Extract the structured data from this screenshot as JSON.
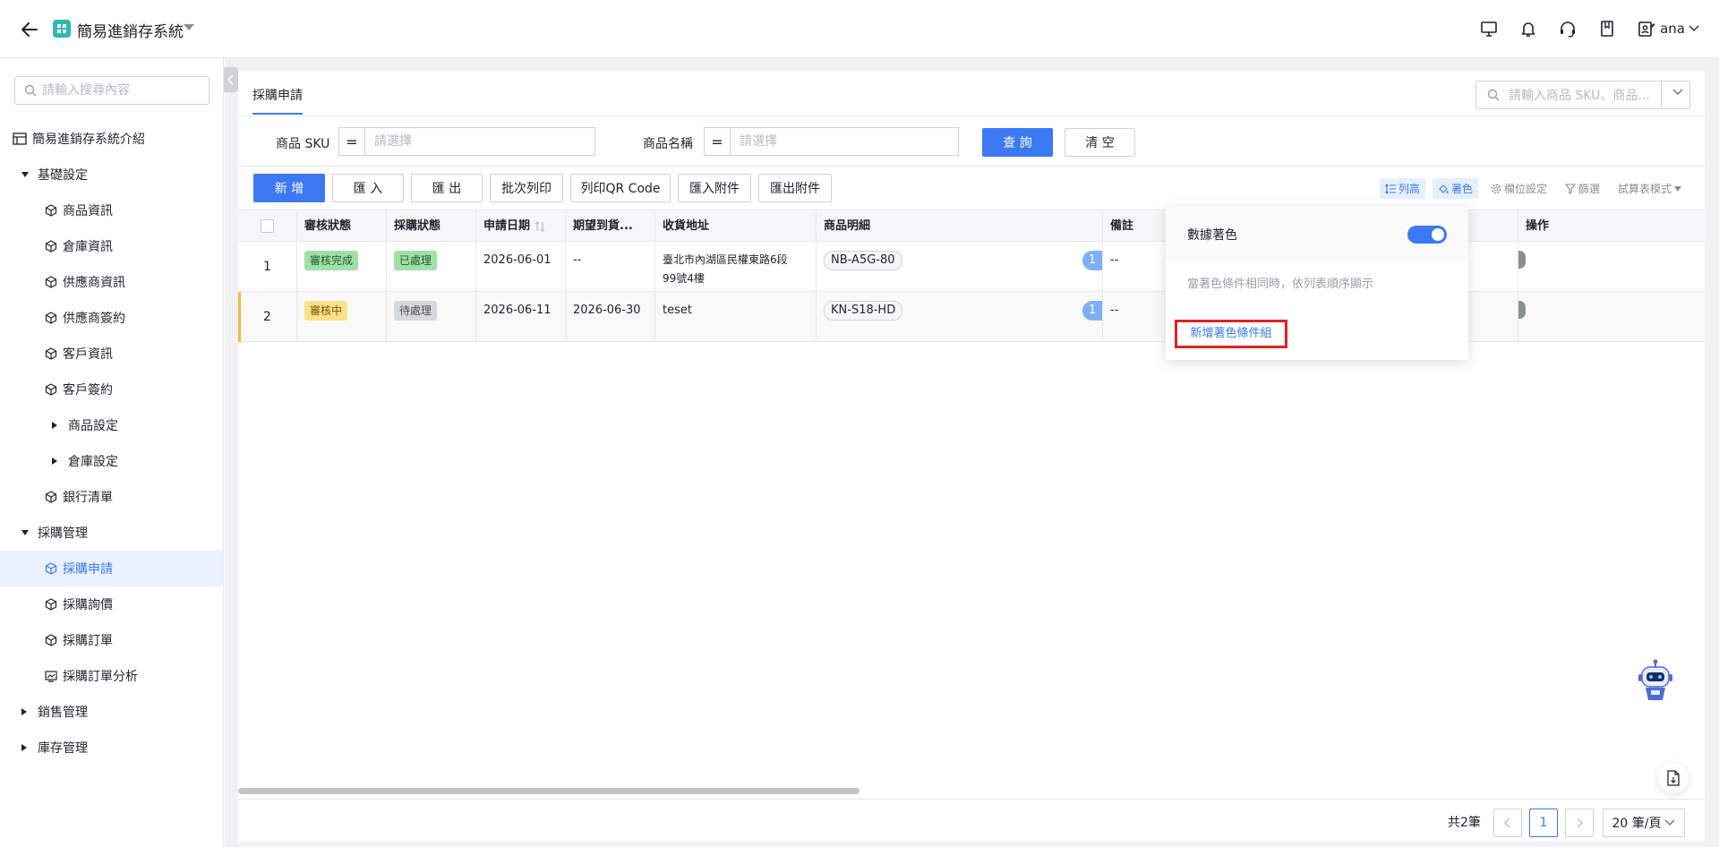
{
  "app": {
    "title": "簡易進銷存系統",
    "user": "ana"
  },
  "colors": {
    "accent": "#3b79f5",
    "success": "#9fe0a8",
    "warning": "#fde08c",
    "highlight_bar": "#f3b93c",
    "alert_outline": "#e0231f"
  },
  "sidebar": {
    "search_placeholder": "請輸入搜尋內容",
    "intro": "簡易進銷存系統介紹",
    "groups": [
      {
        "label": "基礎設定",
        "items": [
          "商品資訊",
          "倉庫資訊",
          "供應商資訊",
          "供應商簽約",
          "客戶資訊",
          "客戶簽約"
        ],
        "subgroups": [
          "商品設定",
          "倉庫設定"
        ],
        "tail_items": [
          "銀行清單"
        ]
      },
      {
        "label": "採購管理",
        "items": [
          "採購申請",
          "採購詢價",
          "採購訂單",
          "採購訂單分析"
        ],
        "active": "採購申請"
      },
      {
        "label": "銷售管理"
      },
      {
        "label": "庫存管理"
      }
    ]
  },
  "main": {
    "tab": "採購申請",
    "search_placeholder": "請輸入商品 SKU、商品...",
    "filters": {
      "sku_label": "商品 SKU",
      "name_label": "商品名稱",
      "operator": "=",
      "placeholder": "請選擇",
      "query": "查 詢",
      "clear": "清 空"
    },
    "toolbar": {
      "buttons": [
        "新 增",
        "匯 入",
        "匯 出",
        "批次列印",
        "列印QR Code",
        "匯入附件",
        "匯出附件"
      ],
      "tools": [
        "列高",
        "著色",
        "欄位設定",
        "篩選",
        "試算表模式"
      ]
    },
    "table": {
      "columns": [
        "審核狀態",
        "採購狀態",
        "申請日期",
        "期望到貨...",
        "收貨地址",
        "商品明細",
        "備註",
        "操作"
      ],
      "rows": [
        {
          "index": "1",
          "review": "審核完成",
          "purchase": "已處理",
          "apply_date": "2026-06-01",
          "expected": "--",
          "address_l1": "臺北市內湖區民權東路6段",
          "address_l2": "99號4樓",
          "sku": "NB-A5G-80",
          "count": "1",
          "note": "--"
        },
        {
          "index": "2",
          "review": "審核中",
          "purchase": "待處理",
          "apply_date": "2026-06-11",
          "expected": "2026-06-30",
          "address_l1": "teset",
          "address_l2": "",
          "sku": "KN-S18-HD",
          "count": "1",
          "note": "--"
        }
      ]
    },
    "popover": {
      "title": "數據著色",
      "hint": "當著色條件相同時，依列表順序顯示",
      "add_link": "新增著色條件組",
      "enabled": true
    },
    "pager": {
      "total": "共2筆",
      "current": "1",
      "size": "20 筆/頁"
    }
  }
}
